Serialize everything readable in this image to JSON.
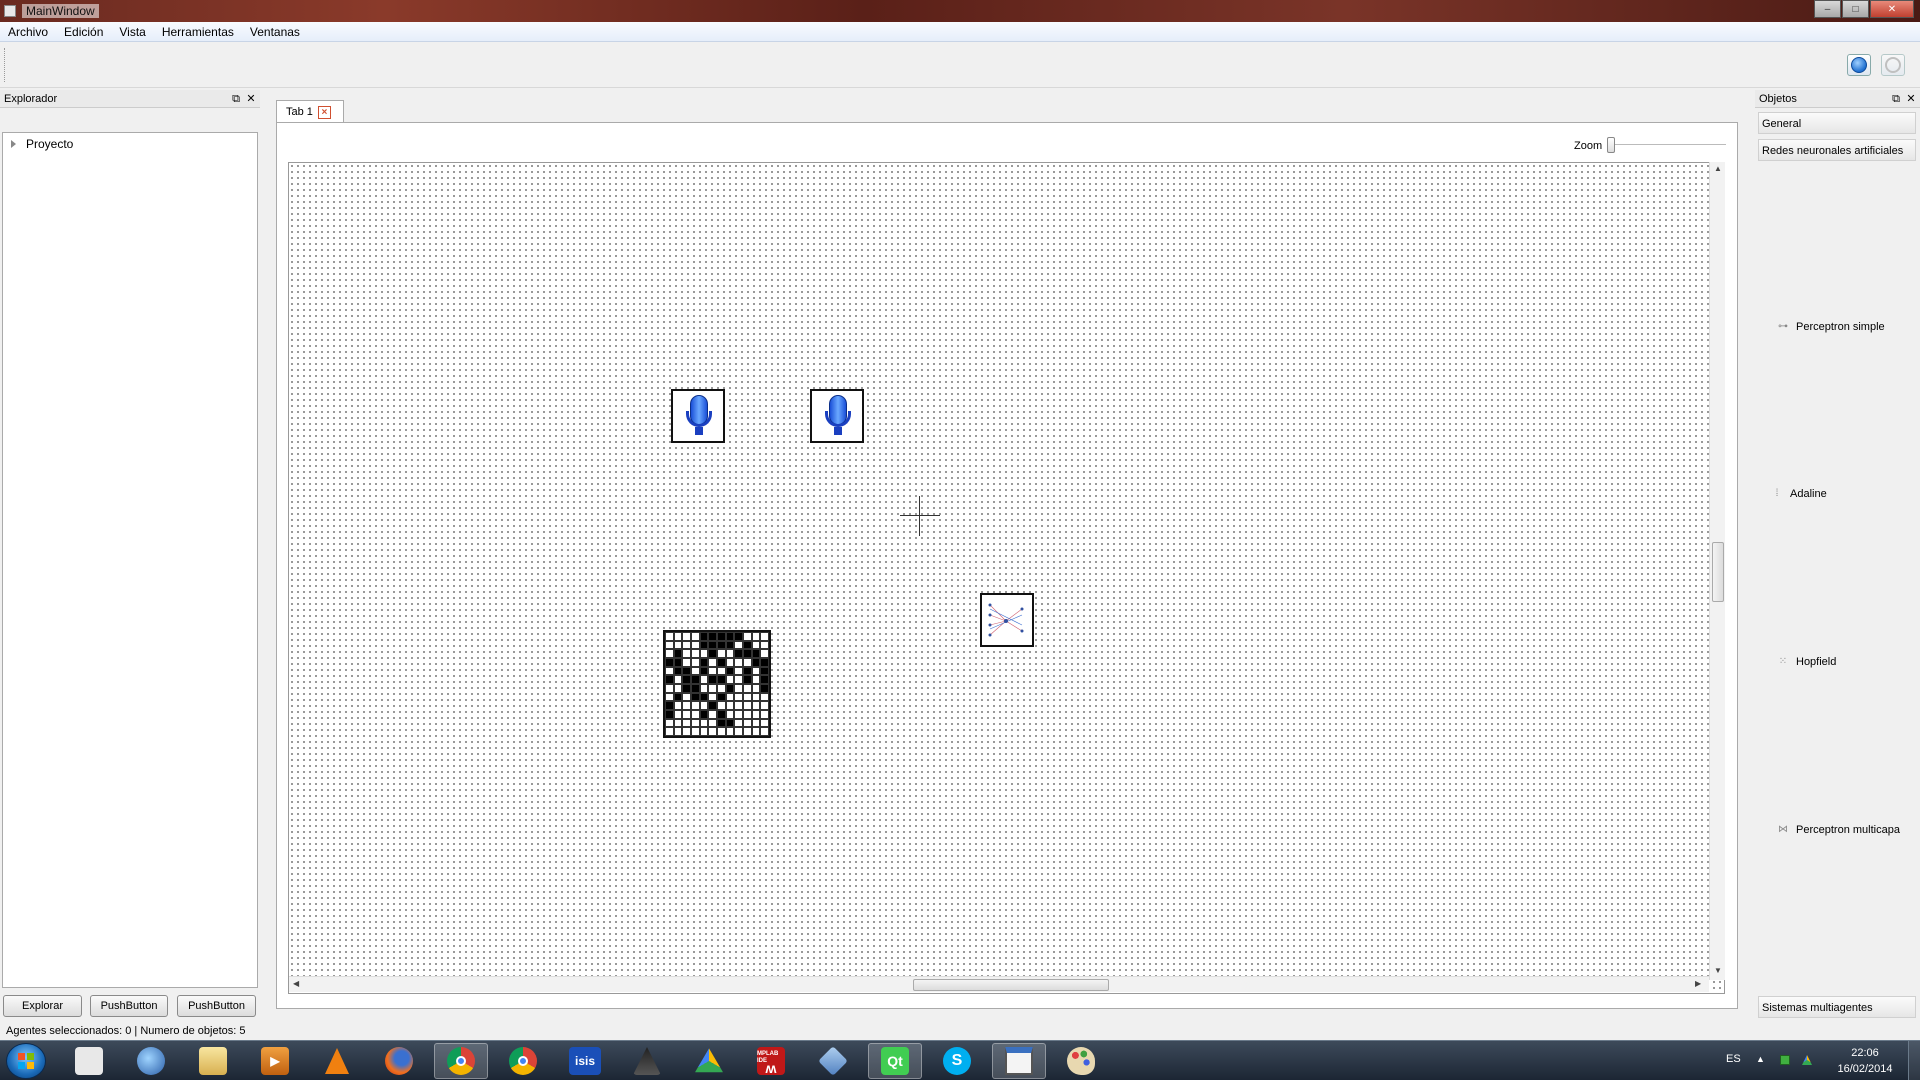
{
  "window": {
    "title": "MainWindow",
    "minimize": "‒",
    "maximize": "□",
    "close": "✕"
  },
  "menu": [
    "Archivo",
    "Edición",
    "Vista",
    "Herramientas",
    "Ventanas"
  ],
  "explorer": {
    "title": "Explorador",
    "tree": [
      {
        "label": "Proyecto"
      }
    ],
    "buttons": [
      "Explorar",
      "PushButton",
      "PushButton"
    ]
  },
  "tabs": [
    {
      "label": "Tab 1",
      "close_glyph": "×"
    }
  ],
  "canvas": {
    "zoom_label": "Zoom",
    "zoom_level": 0,
    "agents": [
      {
        "type": "microphone"
      },
      {
        "type": "microphone"
      },
      {
        "type": "network-diagram"
      },
      {
        "type": "binary-grid",
        "pattern": [
          "000011111000",
          "000011110100",
          "010001001110",
          "110010100011",
          "011010010101",
          "101101100101",
          "001100010001",
          "010110100000",
          "100001000000",
          "100010100000",
          "000000110000",
          "000000000000"
        ]
      }
    ]
  },
  "objects": {
    "title": "Objetos",
    "sections": [
      "General",
      "Redes neuronales artificiales",
      "Sistemas multiagentes"
    ],
    "items": [
      "Perceptron simple",
      "Adaline",
      "Hopfield",
      "Perceptron multicapa"
    ]
  },
  "status": "Agentes seleccionados: 0 | Numero de objetos: 5",
  "taskbar": {
    "apps": [
      "Start",
      "Metro",
      "Thunderbird",
      "Explorer",
      "Media Player",
      "VLC",
      "Firefox",
      "Chrome",
      "Chrome",
      "ISIS",
      "Inkscape",
      "Drive",
      "MPLAB IDE",
      "VirtualBox",
      "Qt",
      "Skype",
      "MainWindow",
      "Paint"
    ],
    "app_text": {
      "isis": "isis",
      "qt": "Qt",
      "mplab_badge": "MPLAB IDE",
      "skype": "S"
    },
    "language": "ES",
    "time": "22:06",
    "date": "16/02/2014"
  }
}
